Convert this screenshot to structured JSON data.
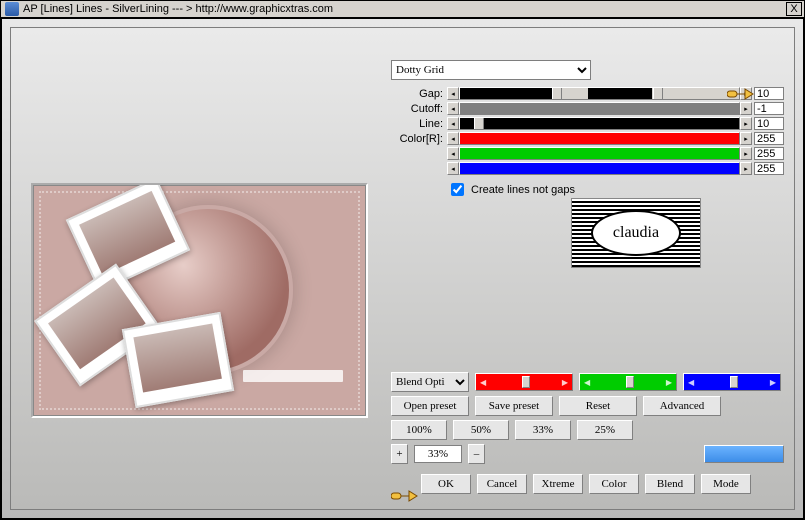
{
  "window": {
    "title": "AP [Lines]  Lines - SilverLining    --- >  http://www.graphicxtras.com",
    "close": "X"
  },
  "preset_dropdown": {
    "selected": "Dotty Grid"
  },
  "sliders": {
    "gap": {
      "label": "Gap:",
      "value": "10",
      "seg1": 33,
      "handle1": 33,
      "seg2_start": 46,
      "seg2_end": 69,
      "handle2": 69
    },
    "cutoff": {
      "label": "Cutoff:",
      "value": "-1",
      "fill": 100,
      "color": "#808080"
    },
    "line": {
      "label": "Line:",
      "value": "10",
      "fill": 100,
      "gap": 5,
      "color": "#000000"
    },
    "r": {
      "label": "Color[R]:",
      "value": "255",
      "fill": 100,
      "color": "#ff0000"
    },
    "g": {
      "label": "",
      "value": "255",
      "fill": 100,
      "color": "#00cc00"
    },
    "b": {
      "label": "",
      "value": "255",
      "fill": 100,
      "color": "#0000ff"
    }
  },
  "checkbox": {
    "label": "Create lines not gaps",
    "checked": true
  },
  "logo_text": "claudia",
  "blend_mode": {
    "label": "Blend Opti"
  },
  "buttons": {
    "open_preset": "Open preset",
    "save_preset": "Save preset",
    "reset": "Reset",
    "advanced": "Advanced",
    "p100": "100%",
    "p50": "50%",
    "p33": "33%",
    "p25": "25%",
    "plus": "+",
    "minus": "–",
    "zoom": "33%",
    "ok": "OK",
    "cancel": "Cancel",
    "xtreme": "Xtreme",
    "color": "Color",
    "blend": "Blend",
    "mode": "Mode"
  }
}
